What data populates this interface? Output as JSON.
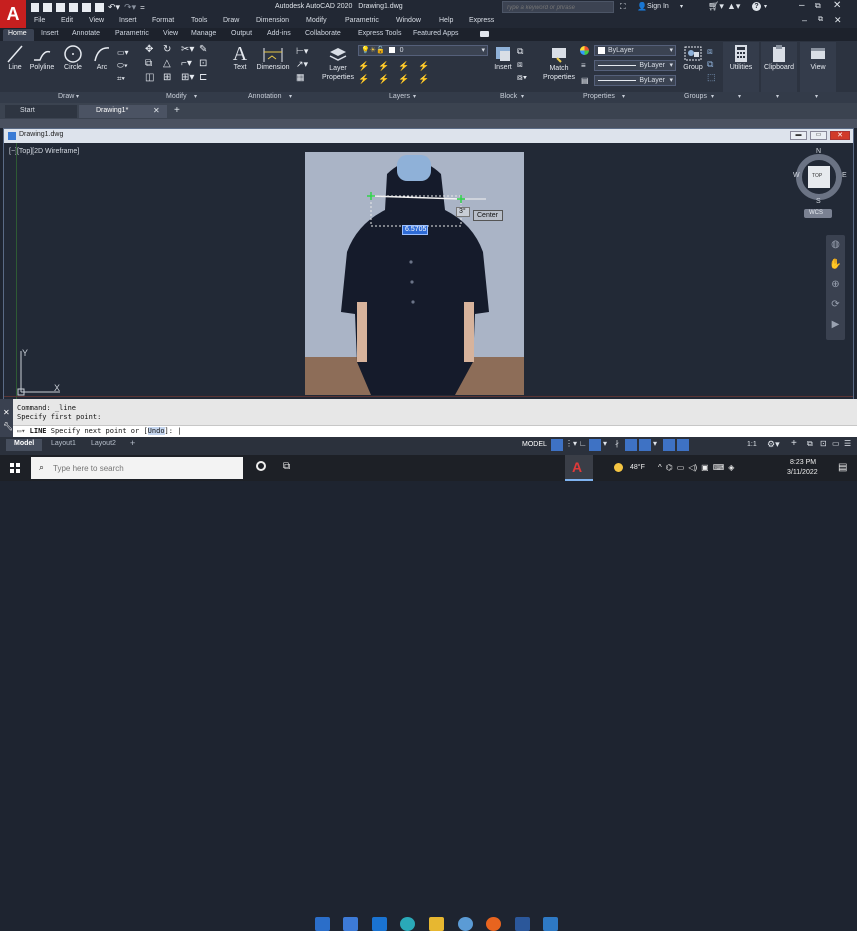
{
  "app": {
    "logo_letter": "A",
    "title": "Autodesk AutoCAD 2020",
    "filename": "Drawing1.dwg",
    "search_placeholder": "Type a keyword or phrase",
    "sign_in": "Sign In"
  },
  "menu": [
    "File",
    "Edit",
    "View",
    "Insert",
    "Format",
    "Tools",
    "Draw",
    "Dimension",
    "Modify",
    "Parametric",
    "Window",
    "Help",
    "Express"
  ],
  "ribbon_tabs": [
    "Home",
    "Insert",
    "Annotate",
    "Parametric",
    "View",
    "Manage",
    "Output",
    "Add-ins",
    "Collaborate",
    "Express Tools",
    "Featured Apps"
  ],
  "ribbon": {
    "draw_tools": [
      "Line",
      "Polyline",
      "Circle",
      "Arc"
    ],
    "text": "Text",
    "dimension": "Dimension",
    "layer_properties": "Layer Properties",
    "layer_value": "0",
    "insert": "Insert",
    "match_properties": "Match Properties",
    "bylayer": [
      "ByLayer",
      "ByLayer",
      "ByLayer"
    ],
    "group": "Group",
    "utilities": "Utilities",
    "clipboard": "Clipboard",
    "view": "View",
    "panels": [
      "Draw",
      "Modify",
      "Annotation",
      "Layers",
      "Block",
      "Properties",
      "Groups"
    ]
  },
  "doc_tabs": {
    "start": "Start",
    "drawing": "Drawing1*"
  },
  "drawing_window": {
    "title": "Drawing1.dwg",
    "viewport_label": "[−][Top][2D Wireframe]",
    "viewcube": {
      "n": "N",
      "s": "S",
      "w": "W",
      "e": "E",
      "top": "TOP",
      "wcs": "WCS"
    },
    "ucs": {
      "x": "X",
      "y": "Y"
    },
    "dim_value": "6.5705",
    "angle_value": "3°",
    "snap_tooltip": "Center"
  },
  "command": {
    "line1": "Command: _line",
    "line2": "Specify first point:",
    "prompt_keyword": "LINE",
    "prompt_text": "Specify next point or [",
    "prompt_option": "Undo",
    "prompt_end": "]:"
  },
  "layout_tabs": [
    "Model",
    "Layout1",
    "Layout2"
  ],
  "status": {
    "model": "MODEL",
    "scale": "1:1"
  },
  "taskbar": {
    "search_placeholder": "Type here to search",
    "weather": "48°F",
    "time": "8:23 PM",
    "date": "3/11/2022"
  },
  "colors": {
    "accent": "#c71f1f",
    "ribbon_bg": "#2c3340",
    "canvas": "#222936",
    "photo_bg": "#aab4c6",
    "floor": "#8d6d58"
  }
}
